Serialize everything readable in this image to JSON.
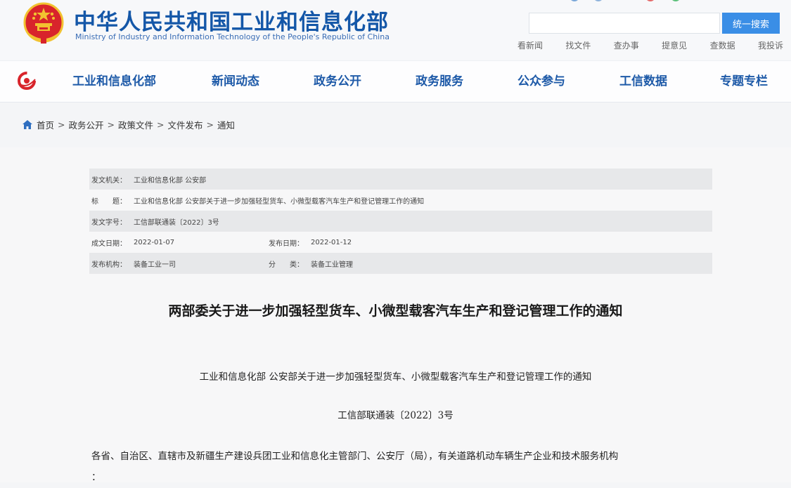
{
  "header": {
    "title": "中华人民共和国工业和信息化部",
    "subtitle": "Ministry of Industry and Information Technology of the People's Republic of China",
    "search_placeholder": "",
    "search_button": "统一搜索",
    "quick_links": [
      "看新闻",
      "找文件",
      "查办事",
      "提意见",
      "查数据",
      "我投诉"
    ]
  },
  "nav": {
    "items": [
      "工业和信息化部",
      "新闻动态",
      "政务公开",
      "政务服务",
      "公众参与",
      "工信数据",
      "专题专栏"
    ]
  },
  "breadcrumb": {
    "items": [
      "首页",
      "政务公开",
      "政策文件",
      "文件发布",
      "通知"
    ],
    "separator": ">"
  },
  "meta": {
    "issuer_label": "发文机关：",
    "issuer_value": "工业和信息化部 公安部",
    "title_label": "标　　题：",
    "title_value": "工业和信息化部 公安部关于进一步加强轻型货车、小微型载客汽车生产和登记管理工作的通知",
    "doc_no_label": "发文字号：",
    "doc_no_value": "工信部联通装〔2022〕3号",
    "written_date_label": "成文日期：",
    "written_date_value": "2022-01-07",
    "publish_date_label": "发布日期：",
    "publish_date_value": "2022-01-12",
    "publisher_label": "发布机构：",
    "publisher_value": "装备工业一司",
    "category_label": "分　　类：",
    "category_value": "装备工业管理"
  },
  "document": {
    "title": "两部委关于进一步加强轻型货车、小微型载客汽车生产和登记管理工作的通知",
    "subtitle": "工业和信息化部 公安部关于进一步加强轻型货车、小微型载客汽车生产和登记管理工作的通知",
    "number": "工信部联通装〔2022〕3号",
    "body_line1": "各省、自治区、直辖市及新疆生产建设兵团工业和信息化主管部门、公安厅（局），有关道路机动车辆生产企业和技术服务机构",
    "body_line2": "："
  },
  "colors": {
    "brand_blue": "#1457a8",
    "nav_blue": "#1e5aa8",
    "search_button": "#3a8ee6",
    "emblem_red": "#d8242b",
    "emblem_gold": "#f2c230"
  }
}
